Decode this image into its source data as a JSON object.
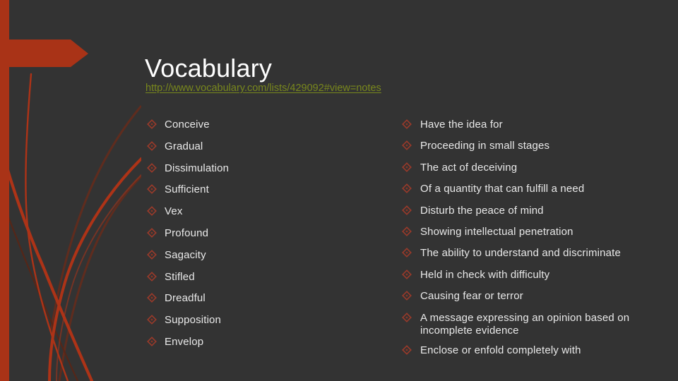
{
  "slide": {
    "title": "Vocabulary",
    "background_color": "#333333",
    "accent_color": "#a93317",
    "text_color": "#e9e9e9",
    "link_color": "#79881d",
    "bullet_glyph": "diamond-outline"
  },
  "link": {
    "text": "http://www.vocabulary.com/lists/429092#view=notes"
  },
  "columns": {
    "terms": [
      "Conceive",
      "Gradual",
      "Dissimulation",
      "Sufficient",
      "Vex",
      "Profound",
      "Sagacity",
      "Stifled",
      "Dreadful",
      "Supposition",
      "Envelop"
    ],
    "definitions": [
      "Have the idea for",
      "Proceeding in small stages",
      "The act of deceiving",
      "Of a quantity that can fulfill a need",
      "Disturb the peace of mind",
      "Showing intellectual penetration",
      "The ability to understand and discriminate",
      "Held in check with difficulty",
      "Causing fear or terror",
      "A message expressing an opinion based on incomplete evidence",
      "Enclose or enfold completely with"
    ]
  }
}
